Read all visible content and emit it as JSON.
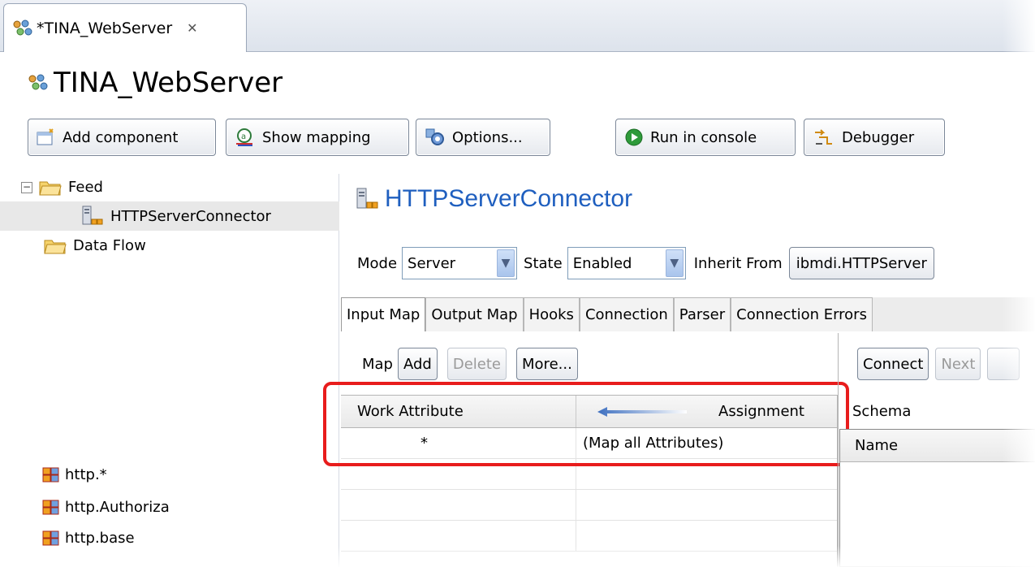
{
  "editor_tab": {
    "title": "*TINA_WebServer",
    "close_glyph": "✕"
  },
  "form": {
    "title": "TINA_WebServer"
  },
  "toolbar": {
    "add_component": "Add component",
    "show_mapping": "Show mapping",
    "options": "Options...",
    "run_in_console": "Run in console",
    "debugger": "Debugger"
  },
  "tree": {
    "feed": "Feed",
    "connector": "HTTPServerConnector",
    "data_flow": "Data Flow",
    "collapse_glyph": "−"
  },
  "connector": {
    "name": "HTTPServerConnector",
    "mode_label": "Mode",
    "mode_value": "Server",
    "state_label": "State",
    "state_value": "Enabled",
    "inherit_label": "Inherit From",
    "inherit_value": "ibmdi.HTTPServer"
  },
  "subtabs": [
    "Input Map",
    "Output Map",
    "Hooks",
    "Connection",
    "Parser",
    "Connection Errors"
  ],
  "map_toolbar": {
    "label": "Map",
    "add": "Add",
    "delete": "Delete",
    "more": "More..."
  },
  "map_table": {
    "col_work": "Work Attribute",
    "col_assign": "Assignment",
    "rows": [
      {
        "work": "*",
        "assign": "(Map all Attributes)"
      }
    ]
  },
  "schema": {
    "connect": "Connect",
    "next": "Next",
    "label": "Schema",
    "col_name": "Name",
    "items": [
      "http.*",
      "http.Authoriza",
      "http.base"
    ]
  },
  "colors": {
    "title_blue": "#1f5fbf",
    "highlight_red": "#e81c1c"
  }
}
